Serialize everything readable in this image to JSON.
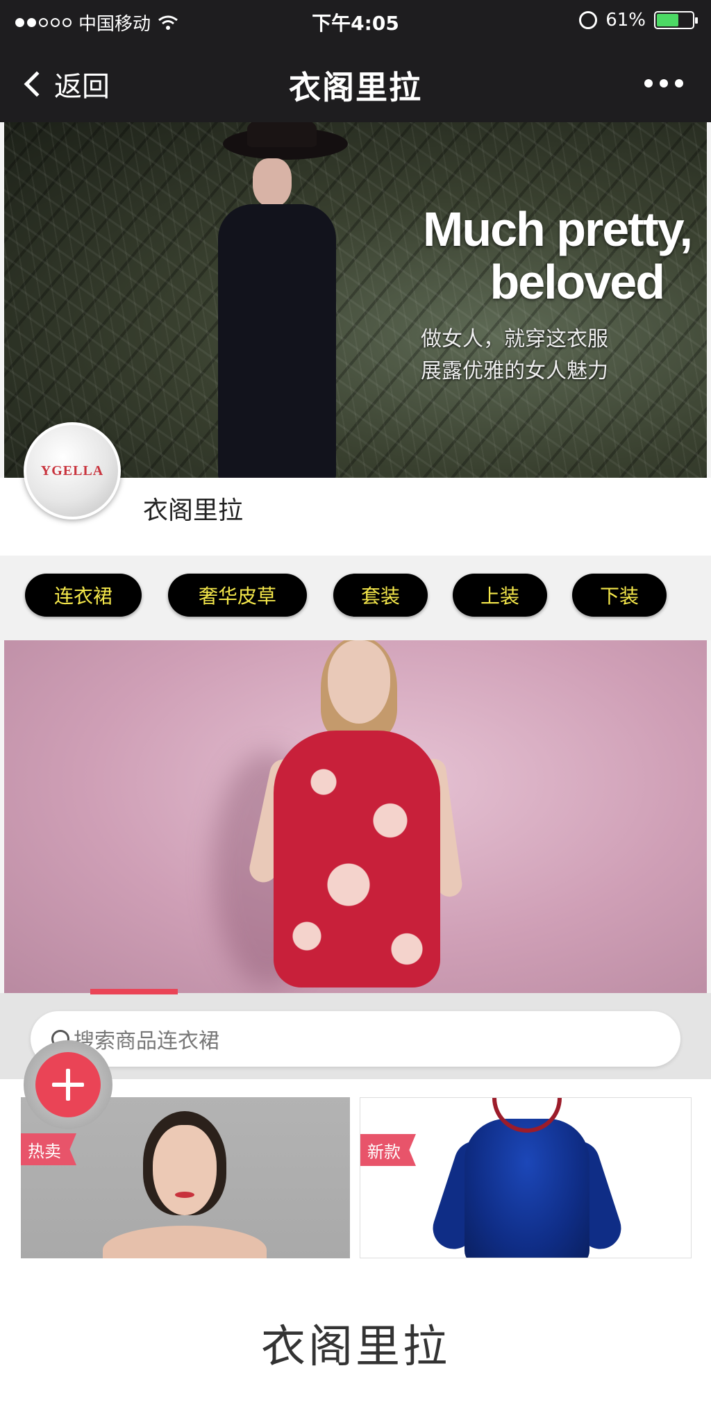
{
  "status_bar": {
    "carrier": "中国移动",
    "time": "下午4:05",
    "battery_percent": "61%",
    "battery_level": 0.61,
    "battery_color": "#4cd964",
    "icons": [
      "signal-dots-icon",
      "wifi-icon",
      "rotation-lock-icon",
      "battery-icon"
    ]
  },
  "nav": {
    "back_label": "返回",
    "title": "衣阁里拉",
    "more_icon": "more-dots-icon"
  },
  "hero": {
    "headline_line1": "Much pretty,",
    "headline_line2": "beloved",
    "subtitle_line1": "做女人，就穿这衣服",
    "subtitle_line2": "展露优雅的女人魅力"
  },
  "brand": {
    "logo_text": "YGELLA",
    "name": "衣阁里拉"
  },
  "categories": [
    "连衣裙",
    "奢华皮草",
    "套装",
    "上装",
    "下装"
  ],
  "search": {
    "placeholder": "搜索商品连衣裙"
  },
  "products": [
    {
      "tag": "热卖"
    },
    {
      "tag": "新款"
    }
  ],
  "footer": {
    "brand": "衣阁里拉"
  },
  "colors": {
    "accent": "#ea4456",
    "pill_bg": "#000000",
    "pill_text": "#f3e64a",
    "nav_bg": "#1e1d1f"
  }
}
